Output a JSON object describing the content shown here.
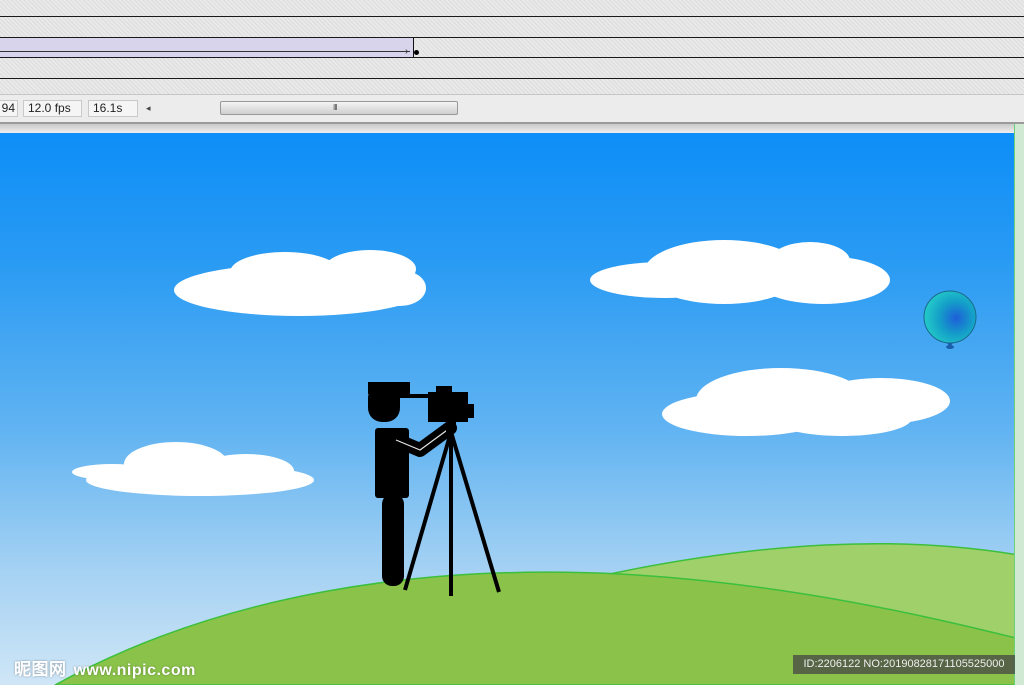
{
  "status_bar": {
    "frame_number": "94",
    "frame_rate": "12.0 fps",
    "elapsed_time": "16.1s",
    "scroll_left_glyph": "◂",
    "scroll_grip_glyph": "III"
  },
  "timeline": {
    "tween_arrow_glyph": "›"
  },
  "colors": {
    "sky_top": "#0b8df8",
    "sky_bottom": "#cfe6f6",
    "hill_front": "#8bc34a",
    "hill_back": "#9fd06a",
    "hill_outline": "#3cbf3c",
    "cloud": "#ffffff",
    "balloon": "#1ab0c0",
    "silhouette": "#000000"
  },
  "icons": {
    "balloon": "balloon-icon",
    "photographer": "photographer-silhouette-icon",
    "tripod_camera": "tripod-camera-icon"
  },
  "watermark": {
    "logo_text": "昵图网",
    "site_text": "www.nipic.com",
    "id_text": "ID:2206122 NO:20190828171105525000"
  }
}
